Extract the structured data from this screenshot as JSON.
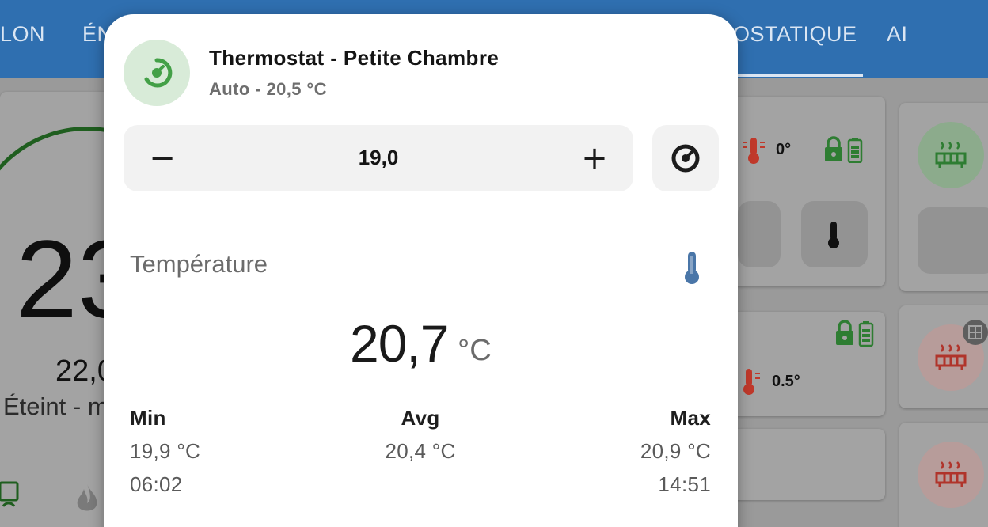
{
  "tabs": [
    "LON",
    "ÉN",
    "OSTATIQUE",
    "AI"
  ],
  "background": {
    "main_temp": "23",
    "sub_temp": "22,0",
    "state": "Éteint - m",
    "card_a_value": "0°",
    "card_b_value": "0.5°"
  },
  "dialog": {
    "title": "Thermostat - Petite Chambre",
    "state": "Auto - 20,5 °C",
    "target_temp": "19,0",
    "minus_label": "−",
    "plus_label": "+",
    "sensor": {
      "title": "Température",
      "value": "20,7",
      "unit": "°C"
    },
    "stats": {
      "min": {
        "label": "Min",
        "value": "19,9 °C",
        "time": "06:02"
      },
      "avg": {
        "label": "Avg",
        "value": "20,4 °C"
      },
      "max": {
        "label": "Max",
        "value": "20,9 °C",
        "time": "14:51"
      }
    }
  },
  "colors": {
    "accent_blue": "#2f6fb0",
    "thermostat_green": "#4caf50",
    "heating_red": "#d43a2f",
    "thermometer_blue": "#4a76a8"
  },
  "icons": [
    "thermostat-auto-icon",
    "thermometer-icon",
    "radiator-icon",
    "lock-icon",
    "battery-icon",
    "fire-icon",
    "calendar-sync-icon"
  ]
}
